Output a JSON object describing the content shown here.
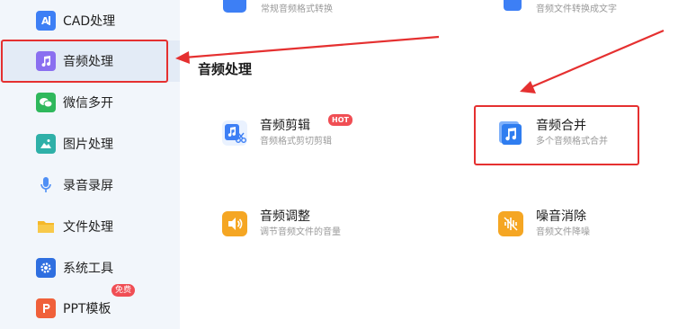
{
  "sidebar": {
    "items": [
      {
        "label": "CAD处理",
        "icon": "cad-icon"
      },
      {
        "label": "音频处理",
        "icon": "music-note-icon"
      },
      {
        "label": "微信多开",
        "icon": "wechat-icon"
      },
      {
        "label": "图片处理",
        "icon": "image-icon"
      },
      {
        "label": "录音录屏",
        "icon": "microphone-icon"
      },
      {
        "label": "文件处理",
        "icon": "folder-icon"
      },
      {
        "label": "系统工具",
        "icon": "gear-icon"
      },
      {
        "label": "PPT模板",
        "icon": "ppt-icon",
        "badge": "免费"
      }
    ],
    "active_index": 1
  },
  "top_partial": {
    "left_sub": "常规音频格式转换",
    "right_sub": "音频文件转换成文字"
  },
  "main": {
    "section_title": "音频处理",
    "cards": [
      {
        "title": "音频剪辑",
        "sub": "音频格式剪切剪辑",
        "badge": "HOT",
        "icon": "audio-cut-icon"
      },
      {
        "title": "音频合并",
        "sub": "多个音频格式合并",
        "icon": "audio-merge-icon"
      },
      {
        "title": "音频调整",
        "sub": "调节音频文件的音量",
        "icon": "volume-icon"
      },
      {
        "title": "噪音消除",
        "sub": "音频文件降噪",
        "icon": "noise-reduce-icon"
      }
    ]
  },
  "colors": {
    "sidebar_bg": "#f2f6fb",
    "highlight_red": "#e53030",
    "badge_red": "#f04e54",
    "icon_blue": "#2f7df0",
    "icon_orange": "#f5a623"
  }
}
